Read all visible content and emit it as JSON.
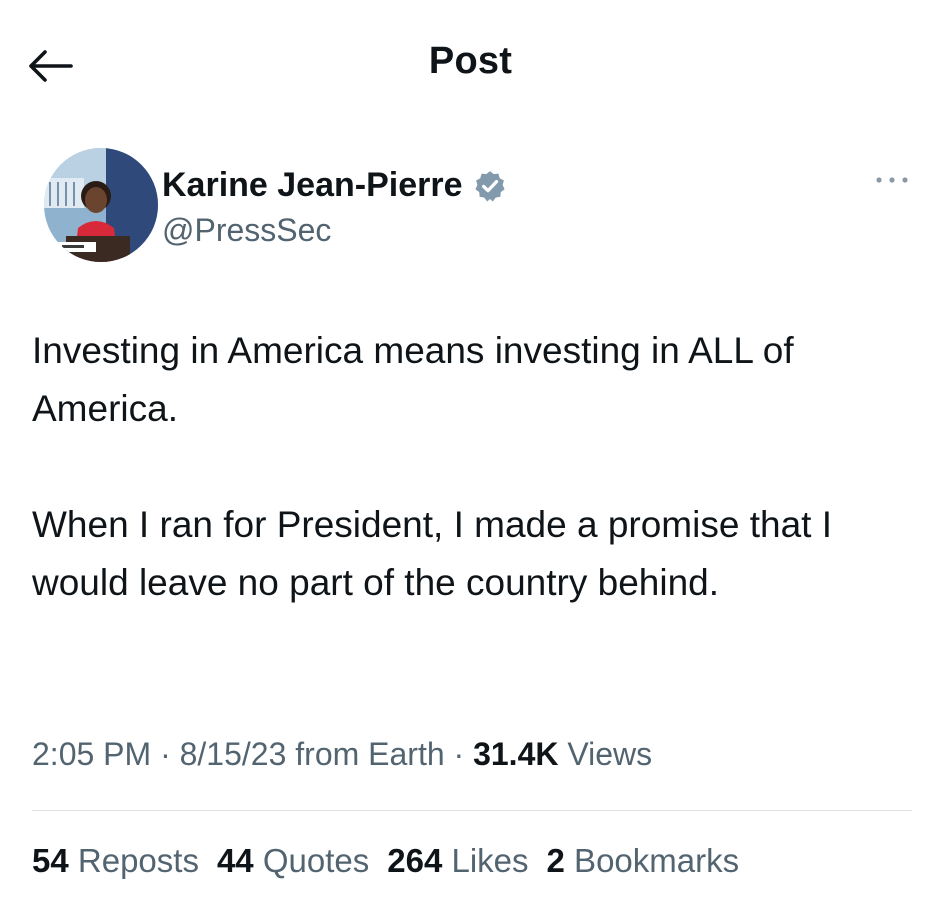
{
  "header": {
    "title": "Post",
    "back_icon": "arrow-left-icon"
  },
  "author": {
    "name": "Karine Jean-Pierre",
    "handle": "@PressSec",
    "verified_icon": "verified-badge-icon",
    "verified_color": "#829aab",
    "more_icon": "more-horizontal-icon"
  },
  "post": {
    "paragraphs": [
      "Investing in America means investing in ALL of America.",
      "When I ran for President, I made a promise that I would leave no part of the country behind."
    ]
  },
  "meta": {
    "time": "2:05 PM",
    "separator": " · ",
    "date_source": "8/15/23 from Earth",
    "views_count": "31.4K",
    "views_label": " Views"
  },
  "stats": {
    "reposts_count": "54",
    "reposts_label": " Reposts",
    "quotes_count": "44",
    "quotes_label": " Quotes",
    "likes_count": "264",
    "likes_label": " Likes",
    "bookmarks_count": "2",
    "bookmarks_label": " Bookmarks"
  },
  "colors": {
    "text_primary": "#0f1419",
    "text_secondary": "#536471",
    "divider": "#dfe3e7"
  }
}
